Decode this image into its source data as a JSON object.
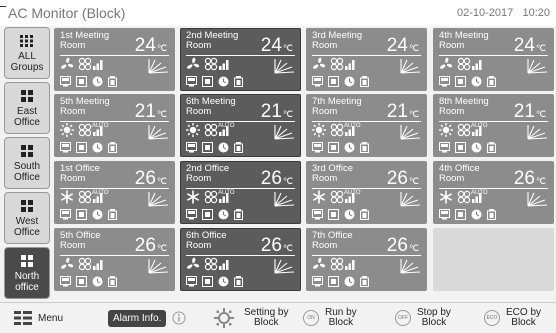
{
  "header": {
    "title": "AC Monitor (Block)",
    "date": "02-10-2017",
    "time": "10:20"
  },
  "sidebar": {
    "items": [
      {
        "label": "ALL\nGroups",
        "active": false
      },
      {
        "label": "East\nOffice",
        "active": false
      },
      {
        "label": "South\nOffice",
        "active": false
      },
      {
        "label": "West\nOffice",
        "active": false
      },
      {
        "label": "North\noffice",
        "active": true
      }
    ]
  },
  "cards": [
    {
      "name": "1st Meeting\nRoom",
      "temp": "24",
      "unit": "℃",
      "mode": "fan",
      "auto": false,
      "style": "light"
    },
    {
      "name": "2nd Meeting\nRoom",
      "temp": "24",
      "unit": "℃",
      "mode": "fan",
      "auto": false,
      "style": "dark"
    },
    {
      "name": "3rd Meeting\nRoom",
      "temp": "24",
      "unit": "℃",
      "mode": "fan",
      "auto": false,
      "style": "light"
    },
    {
      "name": "4th Meeting\nRoom",
      "temp": "24",
      "unit": "℃",
      "mode": "fan",
      "auto": false,
      "style": "light"
    },
    {
      "name": "5th Meeting\nRoom",
      "temp": "21",
      "unit": "℃",
      "mode": "heat",
      "auto": true,
      "style": "light"
    },
    {
      "name": "6th Meeting\nRoom",
      "temp": "21",
      "unit": "℃",
      "mode": "heat",
      "auto": true,
      "style": "dark"
    },
    {
      "name": "7th Meeting\nRoom",
      "temp": "21",
      "unit": "℃",
      "mode": "heat",
      "auto": true,
      "style": "light"
    },
    {
      "name": "8th Meeting\nRoom",
      "temp": "21",
      "unit": "℃",
      "mode": "heat",
      "auto": true,
      "style": "light"
    },
    {
      "name": "1st Office\nRoom",
      "temp": "26",
      "unit": "℃",
      "mode": "cool",
      "auto": true,
      "style": "light"
    },
    {
      "name": "2nd Office\nRoom",
      "temp": "26",
      "unit": "℃",
      "mode": "cool",
      "auto": true,
      "style": "dark"
    },
    {
      "name": "3rd Office\nRoom",
      "temp": "26",
      "unit": "℃",
      "mode": "cool",
      "auto": true,
      "style": "light"
    },
    {
      "name": "4th Office\nRoom",
      "temp": "26",
      "unit": "℃",
      "mode": "cool",
      "auto": true,
      "style": "light"
    },
    {
      "name": "5th Office\nRoom",
      "temp": "26",
      "unit": "℃",
      "mode": "fan",
      "auto": false,
      "style": "light"
    },
    {
      "name": "6th Office\nRoom",
      "temp": "26",
      "unit": "℃",
      "mode": "fan",
      "auto": false,
      "style": "dark"
    },
    {
      "name": "7th Office\nRoom",
      "temp": "26",
      "unit": "℃",
      "mode": "fan",
      "auto": false,
      "style": "light"
    }
  ],
  "auto_label": "AUTO",
  "bottom": {
    "menu": "Menu",
    "alarm": "Alarm Info.",
    "setting": "Setting by\nBlock",
    "run": "Run by\nBlock",
    "run_icon": "ON",
    "stop": "Stop by\nBlock",
    "stop_icon": "OFF",
    "eco": "ECO by\nBlock",
    "eco_icon": "ECO"
  }
}
